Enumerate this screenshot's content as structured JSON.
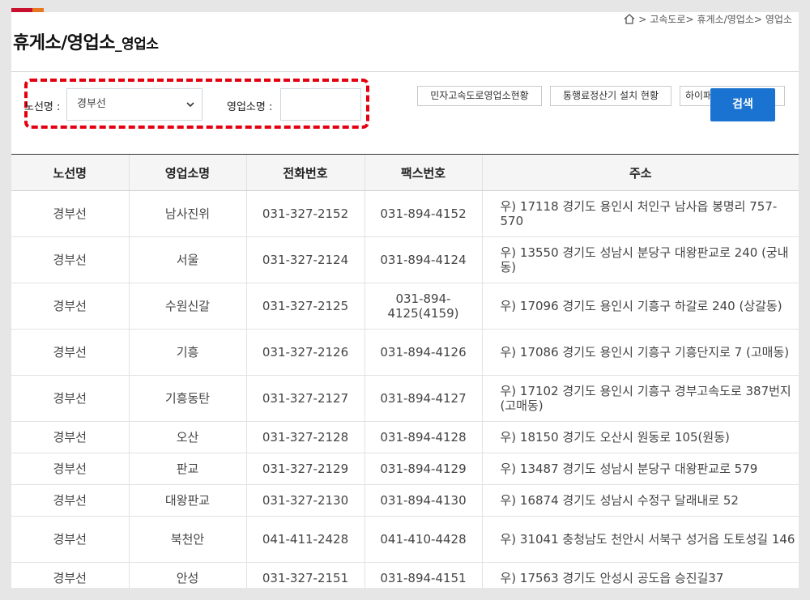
{
  "breadcrumb": [
    "고속도로>",
    "휴게소/영업소>",
    "영업소"
  ],
  "title": {
    "main": "휴게소/영업소",
    "sub": "_영업소"
  },
  "search": {
    "route_label": "노선명 :",
    "route_value": "경부선",
    "name_label": "영업소명 :",
    "name_value": "",
    "search_button": "검색"
  },
  "links": [
    "민자고속도로영업소현황",
    "통행료정산기 설치 현황",
    "하이패스"
  ],
  "table": {
    "headers": [
      "노선명",
      "영업소명",
      "전화번호",
      "팩스번호",
      "주소"
    ],
    "rows": [
      {
        "route": "경부선",
        "name": "남사진위",
        "tel": "031-327-2152",
        "fax": "031-894-4152",
        "addr": "우) 17118 경기도 용인시 처인구 남사읍 봉명리 757-570"
      },
      {
        "route": "경부선",
        "name": "서울",
        "tel": "031-327-2124",
        "fax": "031-894-4124",
        "addr": "우) 13550 경기도 성남시 분당구 대왕판교로 240 (궁내동)"
      },
      {
        "route": "경부선",
        "name": "수원신갈",
        "tel": "031-327-2125",
        "fax": "031-894-4125(4159)",
        "addr": "우) 17096 경기도 용인시 기흥구 하갈로 240 (상갈동)"
      },
      {
        "route": "경부선",
        "name": "기흥",
        "tel": "031-327-2126",
        "fax": "031-894-4126",
        "addr": "우) 17086 경기도 용인시 기흥구 기흥단지로 7 (고매동)"
      },
      {
        "route": "경부선",
        "name": "기흥동탄",
        "tel": "031-327-2127",
        "fax": "031-894-4127",
        "addr": "우) 17102 경기도 용인시 기흥구 경부고속도로 387번지 (고매동)"
      },
      {
        "route": "경부선",
        "name": "오산",
        "tel": "031-327-2128",
        "fax": "031-894-4128",
        "addr": "우) 18150 경기도 오산시 원동로 105(원동)"
      },
      {
        "route": "경부선",
        "name": "판교",
        "tel": "031-327-2129",
        "fax": "031-894-4129",
        "addr": "우) 13487 경기도 성남시 분당구 대왕판교로 579"
      },
      {
        "route": "경부선",
        "name": "대왕판교",
        "tel": "031-327-2130",
        "fax": "031-894-4130",
        "addr": "우) 16874 경기도 성남시 수정구 달래내로 52"
      },
      {
        "route": "경부선",
        "name": "북천안",
        "tel": "041-411-2428",
        "fax": "041-410-4428",
        "addr": "우) 31041 충청남도 천안시 서북구 성거읍 도토성길 146"
      },
      {
        "route": "경부선",
        "name": "안성",
        "tel": "031-327-2151",
        "fax": "031-894-4151",
        "addr": "우) 17563 경기도 안성시 공도읍 승진길37"
      }
    ]
  },
  "colors": {
    "highlight": "#e4000f",
    "search_button": "#1a73d1",
    "accent_red": "#c8102e",
    "accent_orange": "#e87722"
  }
}
